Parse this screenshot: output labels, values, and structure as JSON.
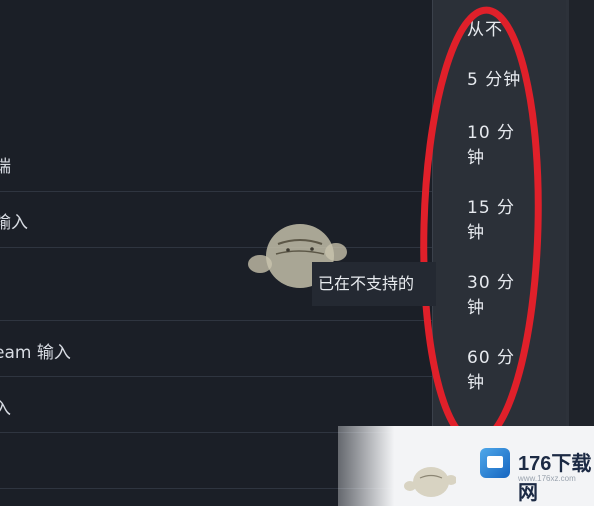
{
  "settings": {
    "rows": [
      {
        "label": "端"
      },
      {
        "label": "输入"
      },
      {
        "label": ""
      },
      {
        "label": "eam 输入"
      },
      {
        "label": "入"
      },
      {
        "label": ""
      }
    ]
  },
  "dropdown": {
    "options": [
      {
        "line1": "从不",
        "line2": ""
      },
      {
        "line1": "5 分钟",
        "line2": ""
      },
      {
        "line1": "10 分",
        "line2": "钟"
      },
      {
        "line1": "15 分",
        "line2": "钟"
      },
      {
        "line1": "30 分",
        "line2": "钟"
      },
      {
        "line1": "60 分",
        "line2": "钟"
      }
    ]
  },
  "toast": {
    "text": "已在不支持的"
  },
  "watermark": {
    "title": "176下载网",
    "url": "www.176xz.com"
  },
  "colors": {
    "highlight": "#e0202a",
    "background": "#1b1f27",
    "menu": "#2b3038"
  }
}
